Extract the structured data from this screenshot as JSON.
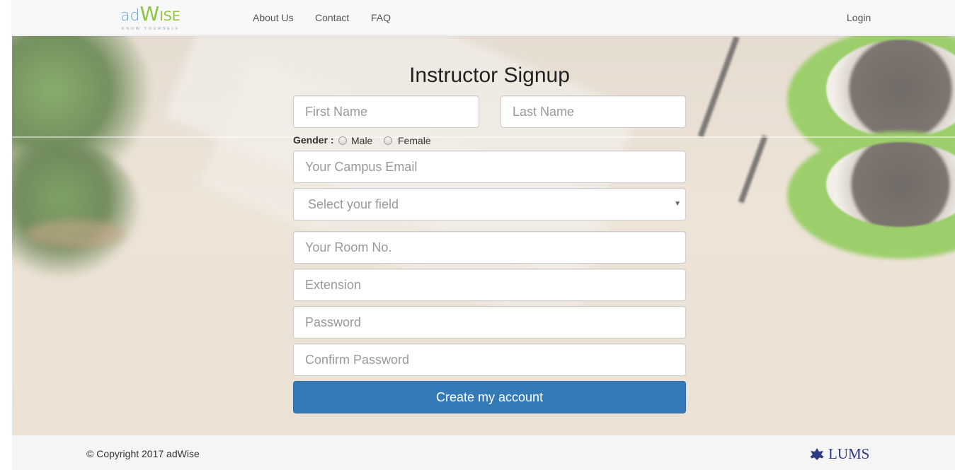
{
  "brand": {
    "logo_ad": "ad",
    "logo_w": "W",
    "logo_ise": "ISE",
    "tagline": "KNOW YOURSELF"
  },
  "nav": {
    "about": "About Us",
    "contact": "Contact",
    "faq": "FAQ",
    "login": "Login"
  },
  "form": {
    "title": "Instructor Signup",
    "first_name_placeholder": "First Name",
    "last_name_placeholder": "Last Name",
    "gender_label": "Gender :",
    "gender_male": "Male",
    "gender_female": "Female",
    "email_placeholder": "Your Campus Email",
    "field_select_value": "Select your field",
    "room_placeholder": "Your Room No.",
    "extension_placeholder": "Extension",
    "password_placeholder": "Password",
    "confirm_password_placeholder": "Confirm Password",
    "submit_label": "Create my account"
  },
  "footer": {
    "copyright": "© Copyright 2017 adWise",
    "partner": "LUMS"
  },
  "colors": {
    "primary_button": "#337ab7",
    "logo_blue": "#6fa1c9",
    "logo_green": "#8dc63f",
    "lums_navy": "#2b3a83"
  }
}
